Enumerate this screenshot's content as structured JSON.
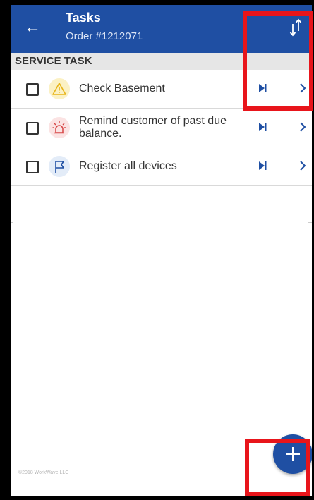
{
  "appbar": {
    "title": "Tasks",
    "subtitle": "Order #1212071",
    "back_icon": "arrow-left-icon",
    "sort_icon": "sort-up-down-icon",
    "color": "#1f4fa3"
  },
  "section": {
    "label": "SERVICE TASK"
  },
  "tasks": [
    {
      "label_line1": "Check Basement",
      "label_line2": "",
      "icon": "warning-triangle-icon",
      "checked": false
    },
    {
      "label_line1": "Remind customer of past due",
      "label_line2": "balance.",
      "icon": "alarm-siren-icon",
      "checked": false
    },
    {
      "label_line1": "Register all devices",
      "label_line2": "",
      "icon": "flag-icon",
      "checked": false
    }
  ],
  "footer": {
    "copyright": "©2018 WorkWave LLC"
  },
  "fab": {
    "icon": "plus-icon"
  },
  "highlight_color": "#e8151b"
}
